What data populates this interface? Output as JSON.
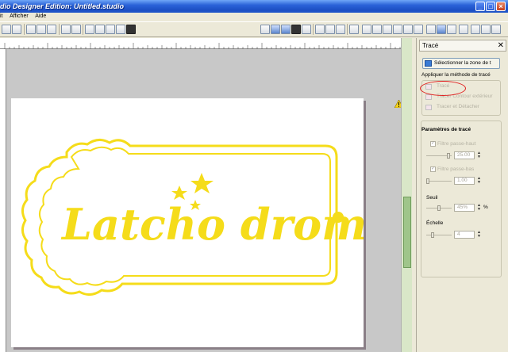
{
  "window": {
    "title": "dio Designer Edition: Untitled.studio",
    "controls": [
      "minimize",
      "maximize",
      "close"
    ]
  },
  "menu": {
    "items": [
      "it",
      "Afficher",
      "Aide"
    ]
  },
  "panel": {
    "title": "Tracé",
    "select_area_label": "Sélectionner la zone de t",
    "method_heading": "Appliquer la méthode de tracé",
    "methods": [
      {
        "label": "Tracé",
        "enabled": false
      },
      {
        "label": "Tracer Contour extérieur",
        "enabled": false
      },
      {
        "label": "Tracer et Détacher",
        "enabled": false
      }
    ],
    "params": {
      "title": "Paramètres de tracé",
      "highpass": {
        "label": "Filtre passe-haut",
        "value": "25.00"
      },
      "lowpass": {
        "label": "Filtre passe-bas",
        "value": "1.00"
      },
      "threshold": {
        "label": "Seuil",
        "value": "45%",
        "unit": "%"
      },
      "scale": {
        "label": "Échelle",
        "value": "4"
      }
    }
  },
  "design": {
    "text": "Latcho drom",
    "color": "#f5dc1a"
  }
}
